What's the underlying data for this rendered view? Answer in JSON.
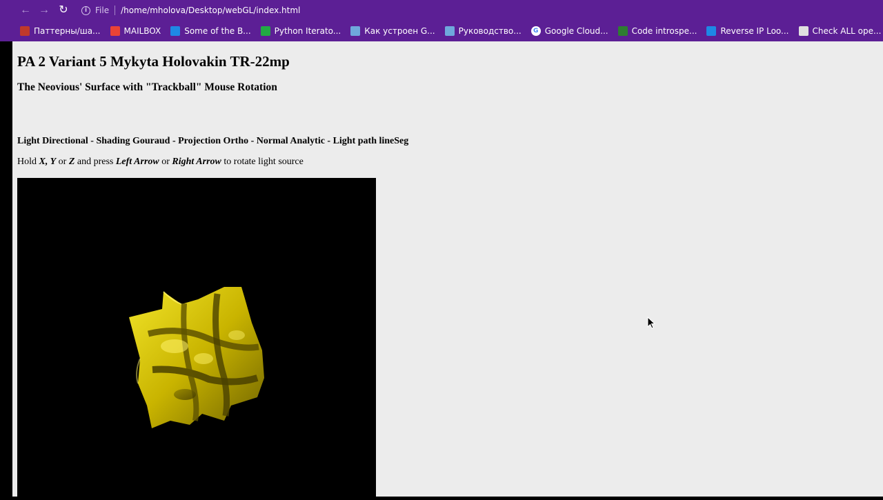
{
  "browser": {
    "scheme": "File",
    "url": "/home/mholova/Desktop/webGL/index.html",
    "bookmarks": [
      {
        "label": "Паттерны/ша...",
        "icon": "opencart-icon",
        "color": "#c0392b"
      },
      {
        "label": "MAILBOX",
        "icon": "gmail-icon",
        "color": "#ea4335"
      },
      {
        "label": "Some of the B...",
        "icon": "k-site-icon",
        "color": "#1e88e5"
      },
      {
        "label": "Python Iterato...",
        "icon": "python-site-icon",
        "color": "#22aa44"
      },
      {
        "label": "Как устроен G...",
        "icon": "bookmark-page-icon",
        "color": "#6fa8dc"
      },
      {
        "label": "Руководство...",
        "icon": "bookmark-page-icon",
        "color": "#6fa8dc"
      },
      {
        "label": "Google Cloud...",
        "icon": "google-icon",
        "color": "#ffffff"
      },
      {
        "label": "Code introspe...",
        "icon": "code-site-icon",
        "color": "#2e7d32"
      },
      {
        "label": "Reverse IP Loo...",
        "icon": "shield-site-icon",
        "color": "#1e88e5"
      },
      {
        "label": "Check ALL ope...",
        "icon": "portcheck-site-icon",
        "color": "#e0e0e0"
      }
    ]
  },
  "page": {
    "title": "PA 2 Variant 5 Mykyta Holovakin TR-22mp",
    "subtitle": "The Neovious' Surface with \"Trackball\" Mouse Rotation",
    "settings": "Light Directional - Shading Gouraud - Projection Ortho - Normal Analytic - Light path lineSeg",
    "instruction": {
      "hold": "Hold ",
      "x": "X, Y",
      "or1": " or ",
      "z": "Z",
      "and_press": " and press ",
      "left": "Left Arrow",
      "or2": " or ",
      "right": "Right Arrow",
      "tail": " to rotate light source"
    },
    "surface_color": "#d4c400"
  }
}
